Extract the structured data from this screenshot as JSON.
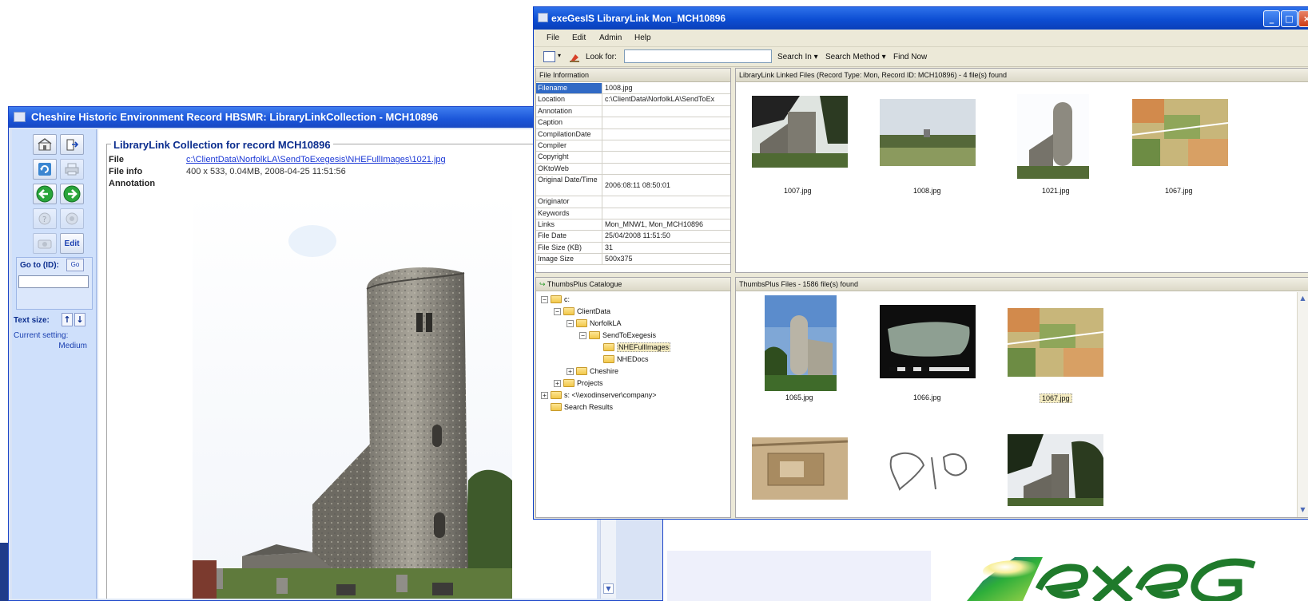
{
  "cheshire": {
    "title": "Cheshire Historic Environment Record HBSMR:   LibraryLinkCollection - MCH10896",
    "collection_heading": "LibraryLink Collection for record MCH10896",
    "file_label": "File",
    "file_value": "c:\\ClientData\\NorfolkLA\\SendToExegesis\\NHEFullImages\\1021.jpg",
    "fileinfo_label": "File info",
    "fileinfo_value": "400 x 533, 0.04MB, 2008-04-25 11:51:56",
    "annotation_label": "Annotation",
    "sidebar": {
      "edit_label": "Edit",
      "goto_label": "Go to (ID):",
      "goto_button": "Go",
      "textsize_label": "Text size:",
      "current_label": "Current setting:",
      "current_value": "Medium"
    }
  },
  "exegesis": {
    "title": "exeGesIS LibraryLink Mon_MCH10896",
    "menu": [
      "File",
      "Edit",
      "Admin",
      "Help"
    ],
    "toolbar": {
      "look_for": "Look for:",
      "search_in": "Search In",
      "search_method": "Search Method",
      "find_now": "Find Now"
    },
    "file_info": {
      "header": "File Information",
      "rows": [
        {
          "key": "Filename",
          "value": "1008.jpg"
        },
        {
          "key": "Location",
          "value": "c:\\ClientData\\NorfolkLA\\SendToEx"
        },
        {
          "key": "Annotation",
          "value": ""
        },
        {
          "key": "Caption",
          "value": ""
        },
        {
          "key": "CompilationDate",
          "value": ""
        },
        {
          "key": "Compiler",
          "value": ""
        },
        {
          "key": "Copyright",
          "value": ""
        },
        {
          "key": "OKtoWeb",
          "value": ""
        },
        {
          "key": "Original Date/Time",
          "value": "2006:08:11 08:50:01"
        },
        {
          "key": "Originator",
          "value": ""
        },
        {
          "key": "Keywords",
          "value": ""
        },
        {
          "key": "Links",
          "value": "Mon_MNW1, Mon_MCH10896"
        },
        {
          "key": "File Date",
          "value": "25/04/2008 11:51:50"
        },
        {
          "key": "File Size (KB)",
          "value": "31"
        },
        {
          "key": "Image Size",
          "value": "500x375"
        }
      ]
    },
    "linked": {
      "header": "LibraryLink Linked Files (Record Type: Mon, Record ID: MCH10896) - 4 file(s) found",
      "items": [
        "1007.jpg",
        "1008.jpg",
        "1021.jpg",
        "1067.jpg"
      ]
    },
    "tree": {
      "header": "ThumbsPlus Catalogue",
      "nodes": [
        "c:",
        "ClientData",
        "NorfolkLA",
        "SendToExegesis",
        "NHEFullImages",
        "NHEDocs",
        "Cheshire",
        "Projects",
        "s: <\\\\exodinserver\\company>",
        "Search Results"
      ]
    },
    "thumbsplus": {
      "header": "ThumbsPlus Files - 1586 file(s) found",
      "items": [
        "1065.jpg",
        "1066.jpg",
        "1067.jpg"
      ]
    }
  },
  "colors": {
    "xp_blue": "#1b55d8",
    "panel_beige": "#ece9d8",
    "selection": "#316ac5",
    "link": "#1a37d6"
  }
}
